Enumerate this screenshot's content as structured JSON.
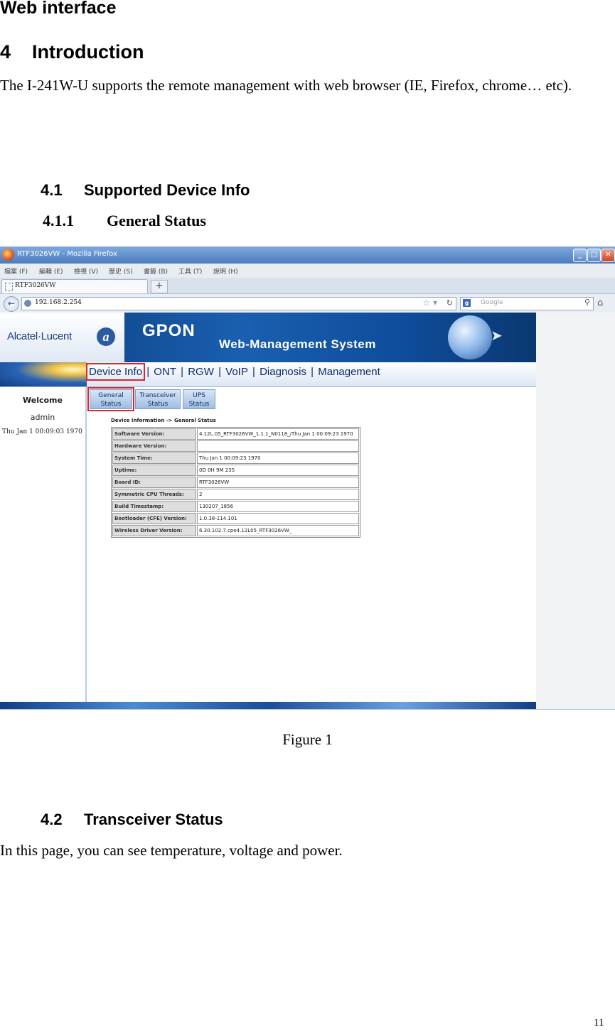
{
  "doc_heading": "Web interface",
  "section4": {
    "number": "4",
    "title": "Introduction"
  },
  "intro_paragraph": "The I-241W-U supports the remote management with web browser (IE, Firefox, chrome… etc).",
  "section4_1": {
    "number": "4.1",
    "title": "Supported Device Info"
  },
  "section4_1_1": {
    "number": "4.1.1",
    "title": "General Status"
  },
  "figure": {
    "caption": "Figure 1",
    "browser": {
      "window_title": "RTF3026VW - Mozilla Firefox",
      "menu": [
        "檔案 (F)",
        "編輯 (E)",
        "檢視 (V)",
        "歷史 (S)",
        "書籤 (B)",
        "工具 (T)",
        "說明 (H)"
      ],
      "tab_title": "RTF3026VW",
      "new_tab_label": "+",
      "url": "192.168.2.254",
      "search_engine_icon": "google-g-icon",
      "search_placeholder": "Google",
      "window_buttons": [
        "_",
        "□",
        "✕"
      ]
    },
    "app": {
      "brand": "Alcatel·Lucent",
      "brand_mark": "a",
      "title": "GPON",
      "subtitle": "Web-Management System",
      "nav": [
        "Device Info",
        "ONT",
        "RGW",
        "VoIP",
        "Diagnosis",
        "Management"
      ],
      "nav_separator": "|",
      "welcome": "Welcome",
      "user": "admin",
      "clock": "Thu Jan 1 00:09:03 1970",
      "subtabs": [
        {
          "line1": "General",
          "line2": "Status"
        },
        {
          "line1": "Transceiver",
          "line2": "Status"
        },
        {
          "line1": "UPS",
          "line2": "Status"
        }
      ],
      "breadcrumb": "Device Information -> General Status",
      "table": [
        {
          "key": "Software Version:",
          "value": "4.12L.05_RTF3026VW_1.1.1_N0118_/Thu Jan 1 00:09:23 1970"
        },
        {
          "key": "Hardware Version:",
          "value": ""
        },
        {
          "key": "System Time:",
          "value": "Thu Jan 1 00:09:23 1970"
        },
        {
          "key": "Uptime:",
          "value": "0D 0H 9M 23S"
        },
        {
          "key": "Board ID:",
          "value": "RTF3026VW"
        },
        {
          "key": "Symmetric CPU Threads:",
          "value": "2"
        },
        {
          "key": "Build Timestamp:",
          "value": "130207_1856"
        },
        {
          "key": "Bootloader (CFE) Version:",
          "value": "1.0.38-114.101"
        },
        {
          "key": "Wireless Driver Version:",
          "value": "6.30.102.7.cpe4.12L05_RTF3026VW_"
        }
      ],
      "highlight_color": "#d8282c"
    }
  },
  "section4_2": {
    "number": "4.2",
    "title": "Transceiver Status"
  },
  "para4_2": "In this page, you can see temperature, voltage and power.",
  "page_number": "11"
}
